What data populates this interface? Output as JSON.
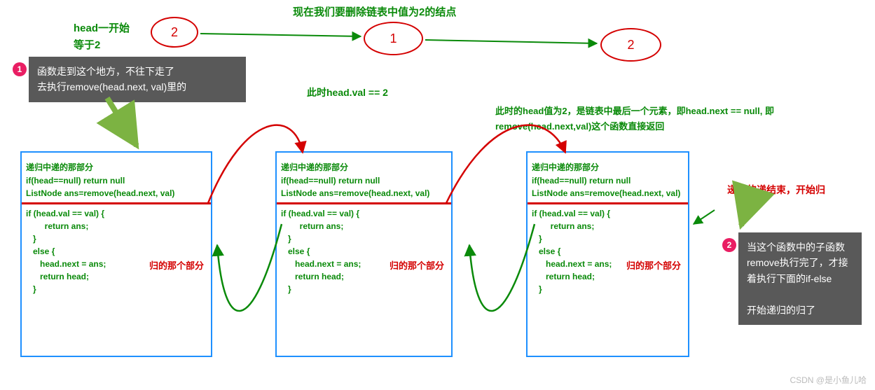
{
  "title": "现在我们要删除链表中值为2的结点",
  "head_label_line1": "head一开始",
  "head_label_line2": "等于2",
  "nodes": {
    "n1": "2",
    "n2": "1",
    "n3": "2"
  },
  "mid_note": "此时head.val == 2",
  "right_note": "此时的head值为2，是链表中最后一个元素，即head.next == null, 即remove(head.next,val)这个函数直接返回",
  "rec_end_label": "递归的递结束，开始归",
  "callout1_line1": "函数走到这个地方，不往下走了",
  "callout1_line2": "去执行remove(head.next, val)里的",
  "callout2_text": "当这个函数中的子函数remove执行完了，才接着执行下面的if-else\n\n开始递归的归了",
  "code": {
    "header": "递归中递的那部分",
    "l1": "if(head==null) return null",
    "l2": "ListNode ans=remove(head.next, val)",
    "l3": "if (head.val == val) {",
    "l4": "        return ans;",
    "l5": "   }",
    "l6": "   else {",
    "l7": "      head.next = ans;",
    "l8": "      return head;",
    "l9": "   }",
    "return_label": "归的那个部分"
  },
  "badge1": "1",
  "badge2": "2",
  "watermark": "CSDN @是小鱼儿哈"
}
